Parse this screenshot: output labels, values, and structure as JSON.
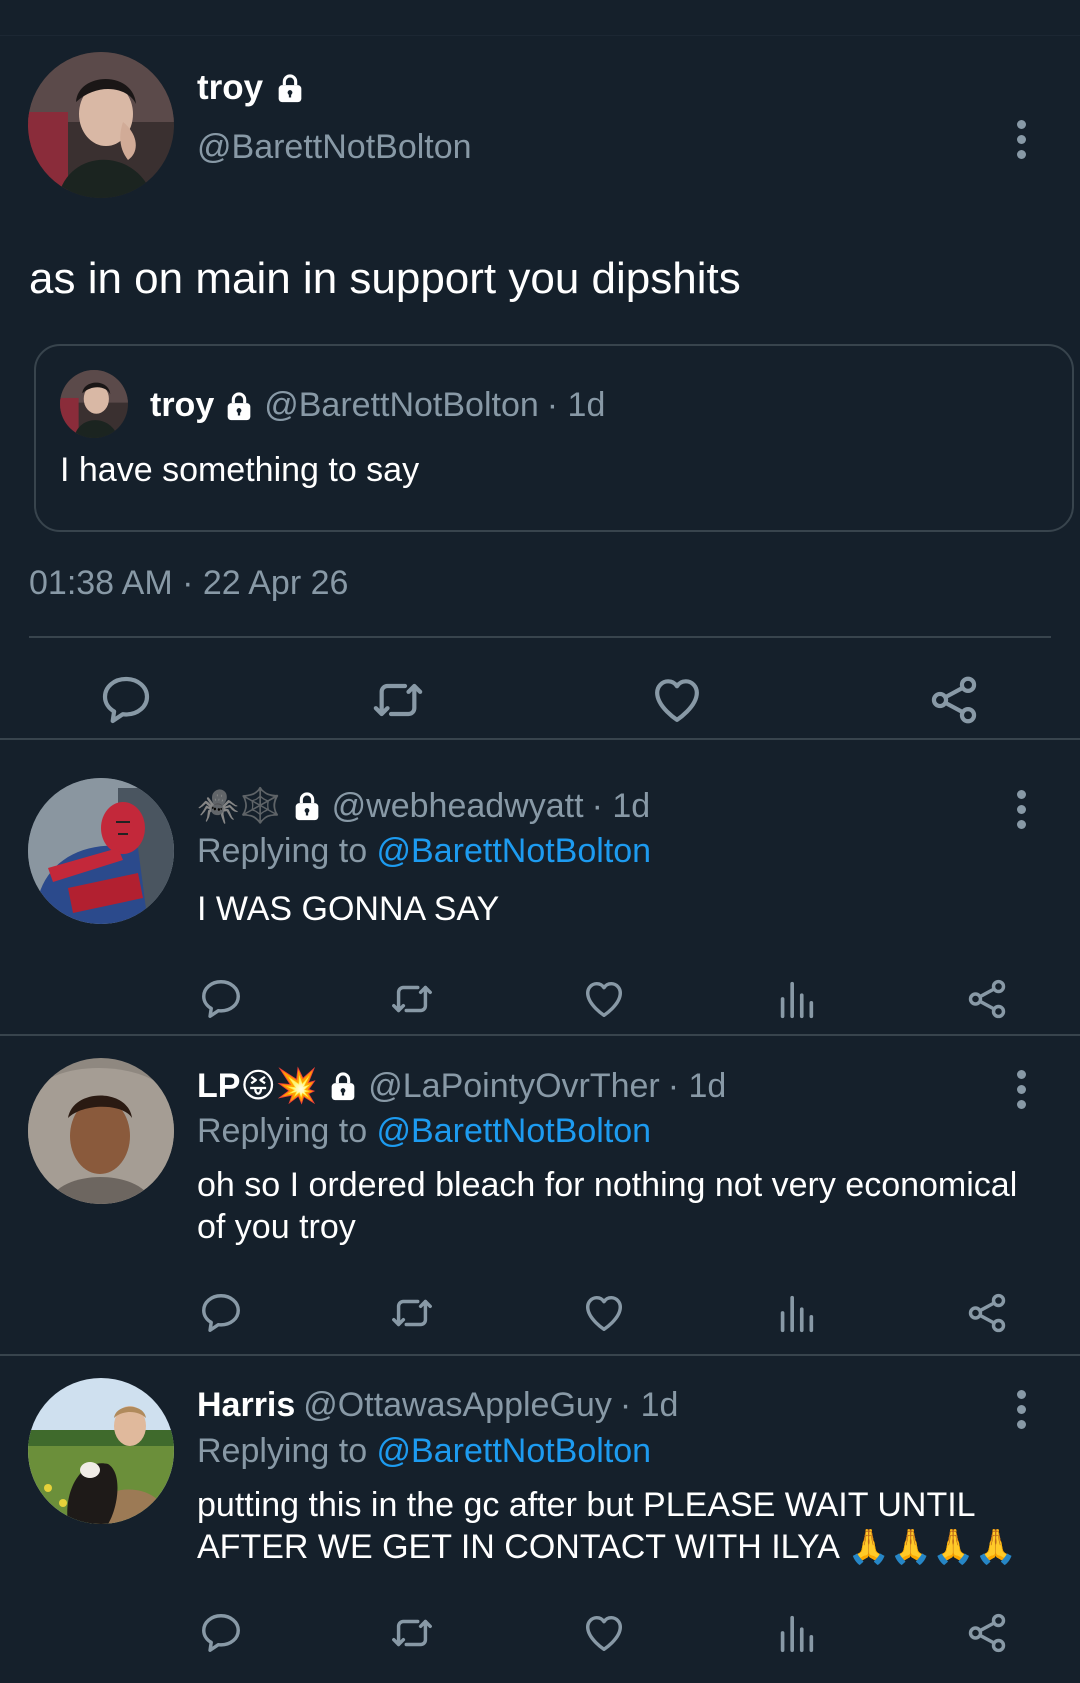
{
  "main_tweet": {
    "name": "troy",
    "handle": "@BarettNotBolton",
    "text": "as in on main in support you dipshits",
    "quote": {
      "name": "troy",
      "handle": "@BarettNotBolton",
      "time": "· 1d",
      "text": "I have something to say"
    },
    "timestamp": "01:38 AM · 22 Apr 26",
    "actions": [
      "comment-icon",
      "retweet-icon",
      "heart-icon",
      "share-icon"
    ]
  },
  "replies": [
    {
      "name": "🕷️🕸️",
      "handle": "@webheadwyatt",
      "time": "· 1d",
      "replying_prefix": "Replying to ",
      "replying_to": "@BarettNotBolton",
      "text": "I WAS GONNA SAY",
      "actions": [
        "comment-icon",
        "retweet-icon",
        "heart-icon",
        "stats-icon",
        "share-icon"
      ]
    },
    {
      "name": "LP😝💥",
      "handle": "@LaPointyOvrTher",
      "time": "· 1d",
      "replying_prefix": "Replying to ",
      "replying_to": "@BarettNotBolton",
      "text": "oh so I ordered bleach for nothing not very economical of you troy",
      "actions": [
        "comment-icon",
        "retweet-icon",
        "heart-icon",
        "stats-icon",
        "share-icon"
      ]
    },
    {
      "name": "Harris",
      "handle": "@OttawasAppleGuy",
      "time": "· 1d",
      "replying_prefix": "Replying to ",
      "replying_to": "@BarettNotBolton",
      "text": "putting this in the gc after but PLEASE WAIT UNTIL AFTER WE GET IN CONTACT WITH ILYA 🙏🙏🙏🙏",
      "actions": [
        "comment-icon",
        "retweet-icon",
        "heart-icon",
        "stats-icon",
        "share-icon"
      ]
    }
  ],
  "colors": {
    "background": "#15202b",
    "secondary_text": "#8899a6",
    "link": "#1d9bf0",
    "border": "#38444d"
  }
}
